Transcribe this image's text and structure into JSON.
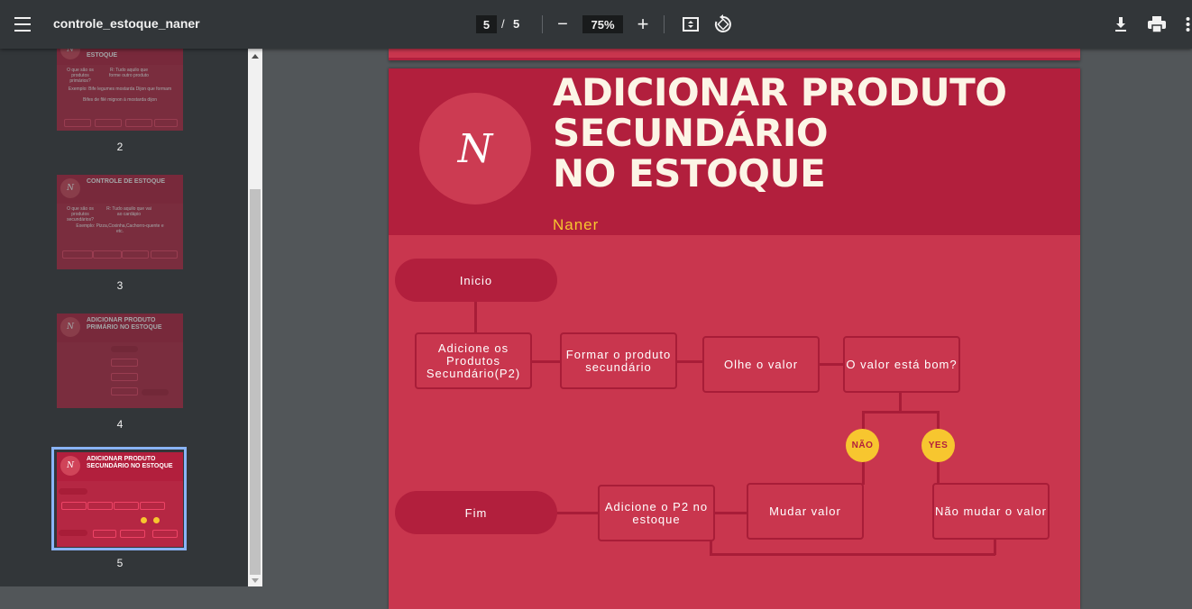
{
  "toolbar": {
    "title": "controle_estoque_naner",
    "page_current": "5",
    "page_separator": "/",
    "page_total": "5",
    "zoom": "75%",
    "zoom_out": "−",
    "zoom_in": "+"
  },
  "sidebar": {
    "thumbnails": [
      {
        "label": "2",
        "title": "ESTOQUE",
        "lines": [
          "O que são os produtos primários?",
          "R: Tudo aquilo que forme outro produto",
          "Exemplo: Bife legumes mostarda Dijon que formam",
          "Bifes de filé mignon à mostarda dijon"
        ]
      },
      {
        "label": "3",
        "title": "CONTROLE DE ESTOQUE",
        "lines": [
          "O que são os produtos secundários?",
          "R: Tudo aquilo que vai ao cardápio",
          "Exemplo: Pizza,Coxinha,Cachorro-quente e etc."
        ]
      },
      {
        "label": "4",
        "title": "ADICIONAR PRODUTO PRIMÁRIO NO ESTOQUE"
      },
      {
        "label": "5",
        "title": "ADICIONAR PRODUTO SECUNDÁRIO NO ESTOQUE"
      }
    ]
  },
  "page": {
    "logo": "N",
    "title_lines": [
      "ADICIONAR PRODUTO",
      "SECUNDÁRIO",
      "NO ESTOQUE"
    ],
    "author": "Naner",
    "flow": {
      "start": "Inicio",
      "step1": "Adicione os Produtos Secundário(P2)",
      "step2": "Formar o produto secundário",
      "step3": "Olhe o valor",
      "decision": "O valor está bom?",
      "no": "NÃO",
      "yes": "YES",
      "end": "Fim",
      "add_p2": "Adicione o P2 no estoque",
      "change": "Mudar valor",
      "keep": "Não mudar o valor"
    }
  },
  "colors": {
    "accent": "#b21f3d",
    "page": "#c9364e",
    "yellow": "#f7c62f",
    "toolbar": "#323639"
  }
}
